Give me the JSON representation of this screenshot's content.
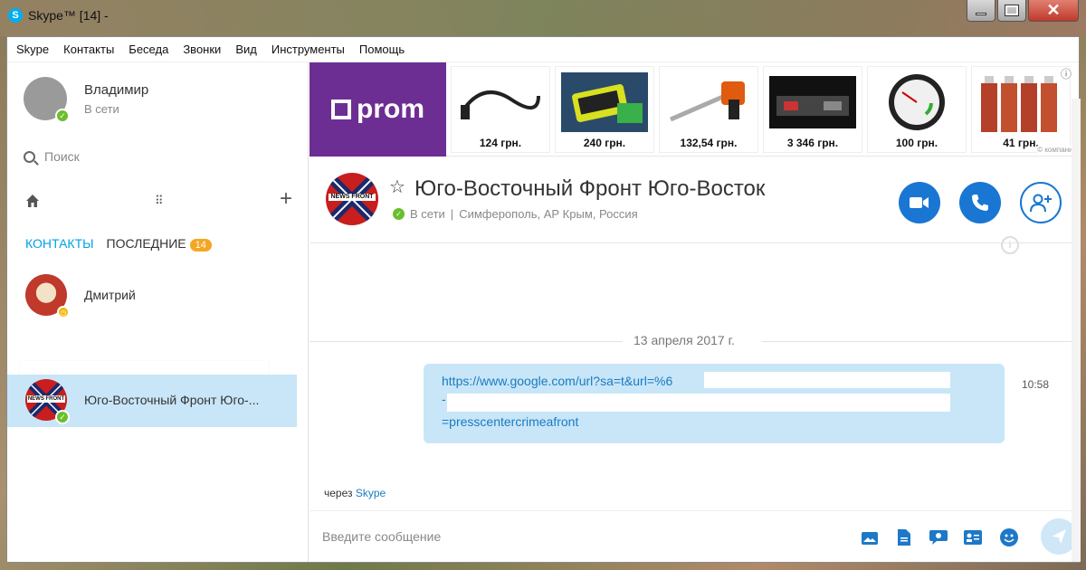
{
  "window": {
    "title": "Skype™ [14] -",
    "app_icon": "skype-icon",
    "controls": [
      "minimize-icon",
      "maximize-icon",
      "close-icon"
    ]
  },
  "menu": [
    "Skype",
    "Контакты",
    "Беседа",
    "Звонки",
    "Вид",
    "Инструменты",
    "Помощь"
  ],
  "profile": {
    "name": "Владимир",
    "status": "В сети"
  },
  "search": {
    "placeholder": "Поиск"
  },
  "tabs": {
    "contacts": "КОНТАКТЫ",
    "recent": "ПОСЛЕДНИЕ",
    "recent_badge": "14"
  },
  "contacts": [
    {
      "name": "Дмитрий",
      "status": "away"
    },
    {
      "name": "Юго-Восточный Фронт Юго-...",
      "status": "online",
      "selected": true
    }
  ],
  "ads": {
    "brand": "prom",
    "items": [
      {
        "price": "124 грн."
      },
      {
        "price": "240 грн."
      },
      {
        "price": "132,54 грн."
      },
      {
        "price": "3 346 грн."
      },
      {
        "price": "100 грн."
      },
      {
        "price": "41 грн."
      }
    ],
    "info_icon": "info-icon",
    "footer": "© компании"
  },
  "chat": {
    "avatar_text": "NEWS FRONT",
    "title": "Юго-Восточный Фронт Юго-Восток",
    "status": "В сети",
    "location": "Симферополь, АР Крым, Россия",
    "date": "13 апреля 2017 г.",
    "message": {
      "line1": "https://www.google.com/url?sa=t&url=%6",
      "line2": "-",
      "line3": "=presscentercrimeafront",
      "time": "10:58"
    },
    "via_prefix": "через",
    "via_link": "Skype"
  },
  "composer": {
    "placeholder": "Введите сообщение"
  },
  "colors": {
    "accent": "#00a0e8",
    "call_button": "#1976d2",
    "bubble": "#c8e6f8",
    "prom": "#6c2e93",
    "online": "#6bbe2d",
    "badge": "#f5a623"
  }
}
